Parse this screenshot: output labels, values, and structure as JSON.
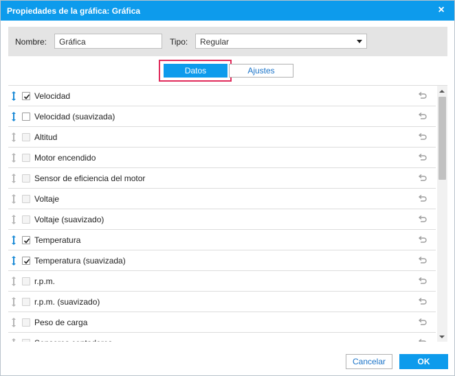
{
  "dialog": {
    "title": "Propiedades de la gráfica: Gráfica",
    "close_glyph": "×"
  },
  "form": {
    "name_label": "Nombre:",
    "name_value": "Gráfica",
    "type_label": "Tipo:",
    "type_value": "Regular"
  },
  "tabs": {
    "data_label": "Datos",
    "settings_label": "Ajustes"
  },
  "colors": {
    "accent": "#0d9bec",
    "highlight_border": "#e02a5a",
    "drag_active": "#1a8ad6",
    "drag_inactive": "#b5b5b5",
    "reset_icon": "#9e9e9e"
  },
  "items": [
    {
      "label": "Velocidad",
      "checked": true,
      "active": true
    },
    {
      "label": "Velocidad (suavizada)",
      "checked": false,
      "active": true
    },
    {
      "label": "Altitud",
      "checked": false,
      "active": false
    },
    {
      "label": "Motor encendido",
      "checked": false,
      "active": false
    },
    {
      "label": "Sensor de eficiencia del motor",
      "checked": false,
      "active": false
    },
    {
      "label": "Voltaje",
      "checked": false,
      "active": false
    },
    {
      "label": "Voltaje (suavizado)",
      "checked": false,
      "active": false
    },
    {
      "label": "Temperatura",
      "checked": true,
      "active": true
    },
    {
      "label": "Temperatura (suavizada)",
      "checked": true,
      "active": true
    },
    {
      "label": "r.p.m.",
      "checked": false,
      "active": false
    },
    {
      "label": "r.p.m. (suavizado)",
      "checked": false,
      "active": false
    },
    {
      "label": "Peso de carga",
      "checked": false,
      "active": false
    },
    {
      "label": "Sensores contadores",
      "checked": false,
      "active": false
    }
  ],
  "footer": {
    "cancel_label": "Cancelar",
    "ok_label": "OK"
  }
}
